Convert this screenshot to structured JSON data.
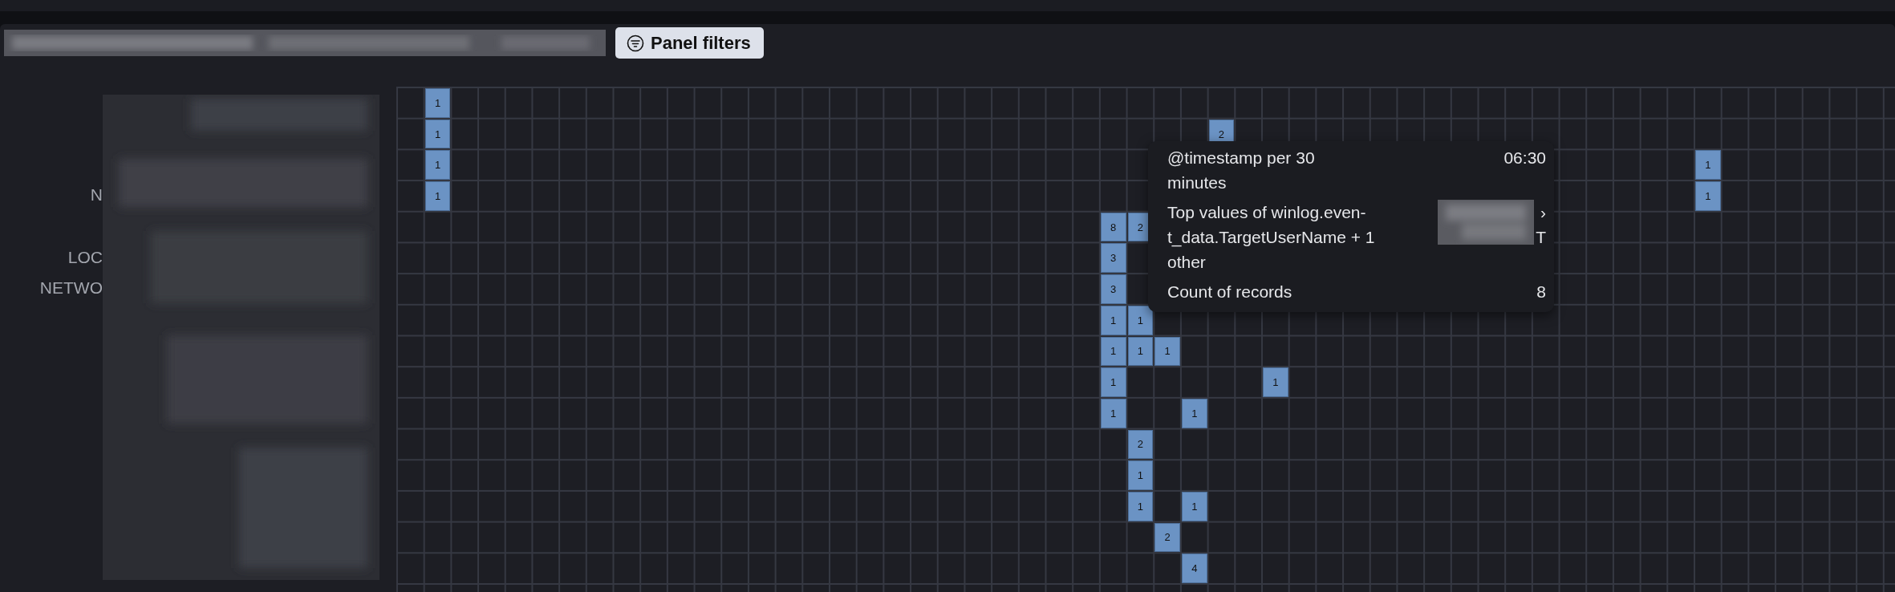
{
  "toolbar": {
    "button": "Panel filters"
  },
  "heatmap": {
    "rows": [
      {
        "cells": [
          "",
          "1"
        ]
      },
      {
        "cells": [
          "",
          "1",
          "",
          "",
          "",
          "",
          "",
          "",
          "",
          "",
          "",
          "",
          "",
          "",
          "",
          "",
          "",
          "",
          "",
          "",
          "",
          "",
          "",
          "",
          "",
          "",
          "",
          "",
          "",
          "",
          "2"
        ]
      },
      {
        "cells": [
          "",
          "1",
          "",
          "",
          "",
          "",
          "",
          "",
          "",
          "",
          "",
          "",
          "",
          "",
          "",
          "",
          "",
          "",
          "",
          "",
          "",
          "",
          "",
          "",
          "",
          "",
          "",
          "",
          "",
          "",
          "",
          "",
          "",
          "",
          "",
          "",
          "",
          "",
          "",
          "",
          "",
          "",
          "",
          "",
          "",
          "",
          "",
          "",
          "1"
        ]
      },
      {
        "label": "N",
        "cells": [
          "",
          "1",
          "",
          "",
          "",
          "",
          "",
          "",
          "",
          "",
          "",
          "",
          "",
          "",
          "",
          "",
          "",
          "",
          "",
          "",
          "",
          "",
          "",
          "",
          "",
          "",
          "",
          "",
          "",
          "",
          "",
          "",
          "",
          "",
          "",
          "",
          "",
          "",
          "",
          "",
          "",
          "",
          "",
          "",
          "",
          "",
          "",
          "",
          "1"
        ]
      },
      {
        "cells": [
          "",
          "",
          "",
          "",
          "",
          "",
          "",
          "",
          "",
          "",
          "",
          "",
          "",
          "",
          "",
          "",
          "",
          "",
          "",
          "",
          "",
          "",
          "",
          "",
          "",
          "",
          "8",
          "2"
        ]
      },
      {
        "label": "LOC",
        "cells": [
          "",
          "",
          "",
          "",
          "",
          "",
          "",
          "",
          "",
          "",
          "",
          "",
          "",
          "",
          "",
          "",
          "",
          "",
          "",
          "",
          "",
          "",
          "",
          "",
          "",
          "",
          "3"
        ]
      },
      {
        "label": "NETWO",
        "cells": [
          "",
          "",
          "",
          "",
          "",
          "",
          "",
          "",
          "",
          "",
          "",
          "",
          "",
          "",
          "",
          "",
          "",
          "",
          "",
          "",
          "",
          "",
          "",
          "",
          "",
          "",
          "3"
        ]
      },
      {
        "cells": [
          "",
          "",
          "",
          "",
          "",
          "",
          "",
          "",
          "",
          "",
          "",
          "",
          "",
          "",
          "",
          "",
          "",
          "",
          "",
          "",
          "",
          "",
          "",
          "",
          "",
          "",
          "1",
          "1"
        ]
      },
      {
        "cells": [
          "",
          "",
          "",
          "",
          "",
          "",
          "",
          "",
          "",
          "",
          "",
          "",
          "",
          "",
          "",
          "",
          "",
          "",
          "",
          "",
          "",
          "",
          "",
          "",
          "",
          "",
          "1",
          "1",
          "1"
        ]
      },
      {
        "cells": [
          "",
          "",
          "",
          "",
          "",
          "",
          "",
          "",
          "",
          "",
          "",
          "",
          "",
          "",
          "",
          "",
          "",
          "",
          "",
          "",
          "",
          "",
          "",
          "",
          "",
          "",
          "1",
          "",
          "",
          "",
          "",
          "",
          "1"
        ]
      },
      {
        "cells": [
          "",
          "",
          "",
          "",
          "",
          "",
          "",
          "",
          "",
          "",
          "",
          "",
          "",
          "",
          "",
          "",
          "",
          "",
          "",
          "",
          "",
          "",
          "",
          "",
          "",
          "",
          "1",
          "",
          "",
          "1"
        ]
      },
      {
        "cells": [
          "",
          "",
          "",
          "",
          "",
          "",
          "",
          "",
          "",
          "",
          "",
          "",
          "",
          "",
          "",
          "",
          "",
          "",
          "",
          "",
          "",
          "",
          "",
          "",
          "",
          "",
          "",
          "2"
        ]
      },
      {
        "cells": [
          "",
          "",
          "",
          "",
          "",
          "",
          "",
          "",
          "",
          "",
          "",
          "",
          "",
          "",
          "",
          "",
          "",
          "",
          "",
          "",
          "",
          "",
          "",
          "",
          "",
          "",
          "",
          "1"
        ]
      },
      {
        "cells": [
          "",
          "",
          "",
          "",
          "",
          "",
          "",
          "",
          "",
          "",
          "",
          "",
          "",
          "",
          "",
          "",
          "",
          "",
          "",
          "",
          "",
          "",
          "",
          "",
          "",
          "",
          "",
          "1",
          "",
          "1"
        ]
      },
      {
        "cells": [
          "",
          "",
          "",
          "",
          "",
          "",
          "",
          "",
          "",
          "",
          "",
          "",
          "",
          "",
          "",
          "",
          "",
          "",
          "",
          "",
          "",
          "",
          "",
          "",
          "",
          "",
          "",
          "",
          "2"
        ]
      },
      {
        "cells": [
          "",
          "",
          "",
          "",
          "",
          "",
          "",
          "",
          "",
          "",
          "",
          "",
          "",
          "",
          "",
          "",
          "",
          "",
          "",
          "",
          "",
          "",
          "",
          "",
          "",
          "",
          "",
          "",
          "",
          "4"
        ]
      }
    ]
  },
  "tooltip": {
    "rows": [
      {
        "label": [
          "@timestamp per 30",
          "minutes"
        ],
        "value": [
          "06:30"
        ]
      },
      {
        "label": [
          "Top values of winlog.even-",
          "t_data.TargetUserName + 1",
          "other"
        ],
        "value": [
          "›",
          "T"
        ],
        "redacted": true
      },
      {
        "label": [
          "Count of records"
        ],
        "value": [
          "8"
        ]
      }
    ]
  }
}
